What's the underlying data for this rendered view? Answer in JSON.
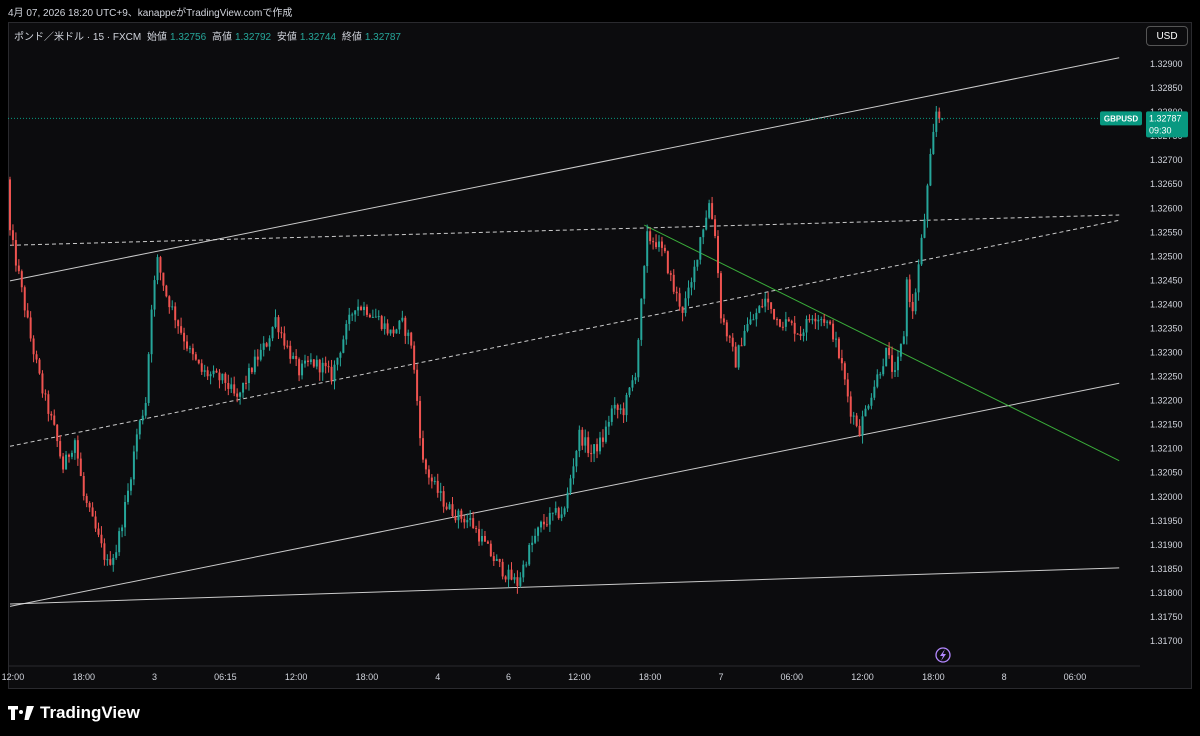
{
  "header": {
    "caption": "4月 07, 2026 18:20 UTC+9、kanappeがTradingView.comで作成"
  },
  "legend": {
    "symbol": "ポンド／米ドル · 15 · FXCM",
    "open_label": "始値",
    "open": "1.32756",
    "high_label": "高値",
    "high": "1.32792",
    "low_label": "安値",
    "low": "1.32744",
    "close_label": "終値",
    "close": "1.32787"
  },
  "currency_button": "USD",
  "price_tag": {
    "symbol": "GBPUSD",
    "price": "1.32787",
    "countdown": "09:30"
  },
  "footer": {
    "brand": "TradingView"
  },
  "colors": {
    "up": "#26a69a",
    "down": "#ef5350",
    "background": "#0c0c0e",
    "trendline": "#e0e0e0",
    "green_line": "#3fbf3f",
    "tag": "#089981"
  },
  "icons": [
    "flash-icon",
    "tradingview-logo-icon"
  ],
  "chart_data": {
    "type": "candlestick",
    "symbol": "GBPUSD",
    "timeframe": "15",
    "y_ticks": [
      "1.32900",
      "1.32850",
      "1.32800",
      "1.32750",
      "1.32700",
      "1.32650",
      "1.32600",
      "1.32550",
      "1.32500",
      "1.32450",
      "1.32400",
      "1.32350",
      "1.32300",
      "1.32250",
      "1.32200",
      "1.32150",
      "1.32100",
      "1.32050",
      "1.32000",
      "1.31950",
      "1.31900",
      "1.31850",
      "1.31800",
      "1.31750",
      "1.31700"
    ],
    "ylim": [
      1.3167,
      1.3292
    ],
    "x_ticks": [
      {
        "label": "12:00",
        "bar": 1
      },
      {
        "label": "18:00",
        "bar": 25
      },
      {
        "label": "3",
        "bar": 49
      },
      {
        "label": "06:15",
        "bar": 73
      },
      {
        "label": "12:00",
        "bar": 97
      },
      {
        "label": "18:00",
        "bar": 121
      },
      {
        "label": "4",
        "bar": 145
      },
      {
        "label": "6",
        "bar": 169
      },
      {
        "label": "12:00",
        "bar": 193
      },
      {
        "label": "18:00",
        "bar": 217
      },
      {
        "label": "7",
        "bar": 241
      },
      {
        "label": "06:00",
        "bar": 265
      },
      {
        "label": "12:00",
        "bar": 289
      },
      {
        "label": "18:00",
        "bar": 313
      },
      {
        "label": "8",
        "bar": 337
      },
      {
        "label": "06:00",
        "bar": 361
      }
    ],
    "path": [
      [
        0,
        1.3266
      ],
      [
        1,
        1.3255
      ],
      [
        4,
        1.3246
      ],
      [
        8,
        1.3233
      ],
      [
        12,
        1.3222
      ],
      [
        16,
        1.3214
      ],
      [
        19,
        1.3206
      ],
      [
        23,
        1.3212
      ],
      [
        26,
        1.32
      ],
      [
        30,
        1.3193
      ],
      [
        34,
        1.3186
      ],
      [
        37,
        1.3189
      ],
      [
        41,
        1.3201
      ],
      [
        44,
        1.3213
      ],
      [
        47,
        1.322
      ],
      [
        49,
        1.324
      ],
      [
        51,
        1.3249
      ],
      [
        54,
        1.3242
      ],
      [
        58,
        1.3236
      ],
      [
        62,
        1.323
      ],
      [
        66,
        1.3226
      ],
      [
        70,
        1.3225
      ],
      [
        74,
        1.3224
      ],
      [
        78,
        1.322
      ],
      [
        80,
        1.3223
      ],
      [
        84,
        1.3228
      ],
      [
        88,
        1.3232
      ],
      [
        91,
        1.3237
      ],
      [
        95,
        1.3231
      ],
      [
        99,
        1.3226
      ],
      [
        103,
        1.3228
      ],
      [
        107,
        1.3227
      ],
      [
        110,
        1.3225
      ],
      [
        114,
        1.3233
      ],
      [
        118,
        1.324
      ],
      [
        122,
        1.3239
      ],
      [
        126,
        1.3237
      ],
      [
        130,
        1.3234
      ],
      [
        134,
        1.3236
      ],
      [
        137,
        1.3232
      ],
      [
        139,
        1.322
      ],
      [
        141,
        1.3207
      ],
      [
        145,
        1.3202
      ],
      [
        149,
        1.3198
      ],
      [
        153,
        1.3196
      ],
      [
        157,
        1.3195
      ],
      [
        161,
        1.3191
      ],
      [
        165,
        1.3187
      ],
      [
        169,
        1.3184
      ],
      [
        173,
        1.3182
      ],
      [
        177,
        1.3189
      ],
      [
        181,
        1.3194
      ],
      [
        185,
        1.3196
      ],
      [
        189,
        1.3197
      ],
      [
        191,
        1.3204
      ],
      [
        194,
        1.3213
      ],
      [
        198,
        1.3209
      ],
      [
        202,
        1.3212
      ],
      [
        205,
        1.3218
      ],
      [
        209,
        1.3218
      ],
      [
        213,
        1.3226
      ],
      [
        215,
        1.324
      ],
      [
        217,
        1.3254
      ],
      [
        220,
        1.3253
      ],
      [
        223,
        1.325
      ],
      [
        226,
        1.3243
      ],
      [
        229,
        1.3239
      ],
      [
        232,
        1.3244
      ],
      [
        235,
        1.3254
      ],
      [
        238,
        1.3261
      ],
      [
        240,
        1.3255
      ],
      [
        242,
        1.3238
      ],
      [
        245,
        1.3232
      ],
      [
        247,
        1.3228
      ],
      [
        250,
        1.3235
      ],
      [
        253,
        1.3237
      ],
      [
        257,
        1.3241
      ],
      [
        261,
        1.3237
      ],
      [
        265,
        1.3236
      ],
      [
        269,
        1.3234
      ],
      [
        273,
        1.3238
      ],
      [
        277,
        1.3237
      ],
      [
        280,
        1.3234
      ],
      [
        283,
        1.3227
      ],
      [
        286,
        1.3218
      ],
      [
        289,
        1.3214
      ],
      [
        292,
        1.322
      ],
      [
        295,
        1.3225
      ],
      [
        298,
        1.323
      ],
      [
        301,
        1.3225
      ],
      [
        304,
        1.3234
      ],
      [
        305,
        1.3245
      ],
      [
        307,
        1.3238
      ],
      [
        309,
        1.3248
      ],
      [
        311,
        1.3258
      ],
      [
        313,
        1.327
      ],
      [
        315,
        1.328
      ],
      [
        316,
        1.3279
      ]
    ],
    "last_price": 1.32787,
    "overlays": [
      {
        "kind": "channel-upper",
        "style": "solid",
        "points": [
          [
            0,
            1.32449
          ],
          [
            376,
            1.32913
          ]
        ]
      },
      {
        "kind": "channel-lower",
        "style": "solid",
        "points": [
          [
            0,
            1.31772
          ],
          [
            376,
            1.32236
          ]
        ]
      },
      {
        "kind": "horizontal-support",
        "style": "solid",
        "points": [
          [
            0,
            1.31777
          ],
          [
            376,
            1.31852
          ]
        ]
      },
      {
        "kind": "mid-line",
        "style": "dashed",
        "points": [
          [
            0,
            1.32105
          ],
          [
            376,
            1.32575
          ]
        ]
      },
      {
        "kind": "resistance",
        "style": "dashed",
        "points": [
          [
            0,
            1.32523
          ],
          [
            376,
            1.32586
          ]
        ]
      },
      {
        "kind": "downtrend",
        "style": "solid",
        "color": "green",
        "points": [
          [
            215,
            1.32565
          ],
          [
            376,
            1.32075
          ]
        ]
      }
    ]
  }
}
